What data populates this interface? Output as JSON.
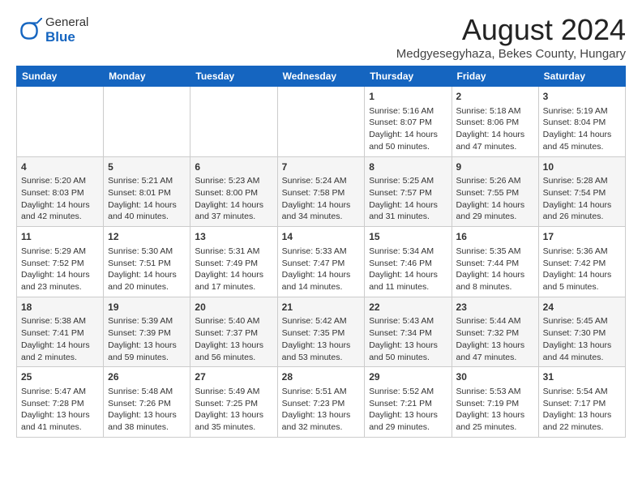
{
  "logo": {
    "general": "General",
    "blue": "Blue"
  },
  "title": "August 2024",
  "subtitle": "Medgyesegyhaza, Bekes County, Hungary",
  "days_header": [
    "Sunday",
    "Monday",
    "Tuesday",
    "Wednesday",
    "Thursday",
    "Friday",
    "Saturday"
  ],
  "weeks": [
    [
      {
        "day": "",
        "info": ""
      },
      {
        "day": "",
        "info": ""
      },
      {
        "day": "",
        "info": ""
      },
      {
        "day": "",
        "info": ""
      },
      {
        "day": "1",
        "info": "Sunrise: 5:16 AM\nSunset: 8:07 PM\nDaylight: 14 hours\nand 50 minutes."
      },
      {
        "day": "2",
        "info": "Sunrise: 5:18 AM\nSunset: 8:06 PM\nDaylight: 14 hours\nand 47 minutes."
      },
      {
        "day": "3",
        "info": "Sunrise: 5:19 AM\nSunset: 8:04 PM\nDaylight: 14 hours\nand 45 minutes."
      }
    ],
    [
      {
        "day": "4",
        "info": "Sunrise: 5:20 AM\nSunset: 8:03 PM\nDaylight: 14 hours\nand 42 minutes."
      },
      {
        "day": "5",
        "info": "Sunrise: 5:21 AM\nSunset: 8:01 PM\nDaylight: 14 hours\nand 40 minutes."
      },
      {
        "day": "6",
        "info": "Sunrise: 5:23 AM\nSunset: 8:00 PM\nDaylight: 14 hours\nand 37 minutes."
      },
      {
        "day": "7",
        "info": "Sunrise: 5:24 AM\nSunset: 7:58 PM\nDaylight: 14 hours\nand 34 minutes."
      },
      {
        "day": "8",
        "info": "Sunrise: 5:25 AM\nSunset: 7:57 PM\nDaylight: 14 hours\nand 31 minutes."
      },
      {
        "day": "9",
        "info": "Sunrise: 5:26 AM\nSunset: 7:55 PM\nDaylight: 14 hours\nand 29 minutes."
      },
      {
        "day": "10",
        "info": "Sunrise: 5:28 AM\nSunset: 7:54 PM\nDaylight: 14 hours\nand 26 minutes."
      }
    ],
    [
      {
        "day": "11",
        "info": "Sunrise: 5:29 AM\nSunset: 7:52 PM\nDaylight: 14 hours\nand 23 minutes."
      },
      {
        "day": "12",
        "info": "Sunrise: 5:30 AM\nSunset: 7:51 PM\nDaylight: 14 hours\nand 20 minutes."
      },
      {
        "day": "13",
        "info": "Sunrise: 5:31 AM\nSunset: 7:49 PM\nDaylight: 14 hours\nand 17 minutes."
      },
      {
        "day": "14",
        "info": "Sunrise: 5:33 AM\nSunset: 7:47 PM\nDaylight: 14 hours\nand 14 minutes."
      },
      {
        "day": "15",
        "info": "Sunrise: 5:34 AM\nSunset: 7:46 PM\nDaylight: 14 hours\nand 11 minutes."
      },
      {
        "day": "16",
        "info": "Sunrise: 5:35 AM\nSunset: 7:44 PM\nDaylight: 14 hours\nand 8 minutes."
      },
      {
        "day": "17",
        "info": "Sunrise: 5:36 AM\nSunset: 7:42 PM\nDaylight: 14 hours\nand 5 minutes."
      }
    ],
    [
      {
        "day": "18",
        "info": "Sunrise: 5:38 AM\nSunset: 7:41 PM\nDaylight: 14 hours\nand 2 minutes."
      },
      {
        "day": "19",
        "info": "Sunrise: 5:39 AM\nSunset: 7:39 PM\nDaylight: 13 hours\nand 59 minutes."
      },
      {
        "day": "20",
        "info": "Sunrise: 5:40 AM\nSunset: 7:37 PM\nDaylight: 13 hours\nand 56 minutes."
      },
      {
        "day": "21",
        "info": "Sunrise: 5:42 AM\nSunset: 7:35 PM\nDaylight: 13 hours\nand 53 minutes."
      },
      {
        "day": "22",
        "info": "Sunrise: 5:43 AM\nSunset: 7:34 PM\nDaylight: 13 hours\nand 50 minutes."
      },
      {
        "day": "23",
        "info": "Sunrise: 5:44 AM\nSunset: 7:32 PM\nDaylight: 13 hours\nand 47 minutes."
      },
      {
        "day": "24",
        "info": "Sunrise: 5:45 AM\nSunset: 7:30 PM\nDaylight: 13 hours\nand 44 minutes."
      }
    ],
    [
      {
        "day": "25",
        "info": "Sunrise: 5:47 AM\nSunset: 7:28 PM\nDaylight: 13 hours\nand 41 minutes."
      },
      {
        "day": "26",
        "info": "Sunrise: 5:48 AM\nSunset: 7:26 PM\nDaylight: 13 hours\nand 38 minutes."
      },
      {
        "day": "27",
        "info": "Sunrise: 5:49 AM\nSunset: 7:25 PM\nDaylight: 13 hours\nand 35 minutes."
      },
      {
        "day": "28",
        "info": "Sunrise: 5:51 AM\nSunset: 7:23 PM\nDaylight: 13 hours\nand 32 minutes."
      },
      {
        "day": "29",
        "info": "Sunrise: 5:52 AM\nSunset: 7:21 PM\nDaylight: 13 hours\nand 29 minutes."
      },
      {
        "day": "30",
        "info": "Sunrise: 5:53 AM\nSunset: 7:19 PM\nDaylight: 13 hours\nand 25 minutes."
      },
      {
        "day": "31",
        "info": "Sunrise: 5:54 AM\nSunset: 7:17 PM\nDaylight: 13 hours\nand 22 minutes."
      }
    ]
  ]
}
